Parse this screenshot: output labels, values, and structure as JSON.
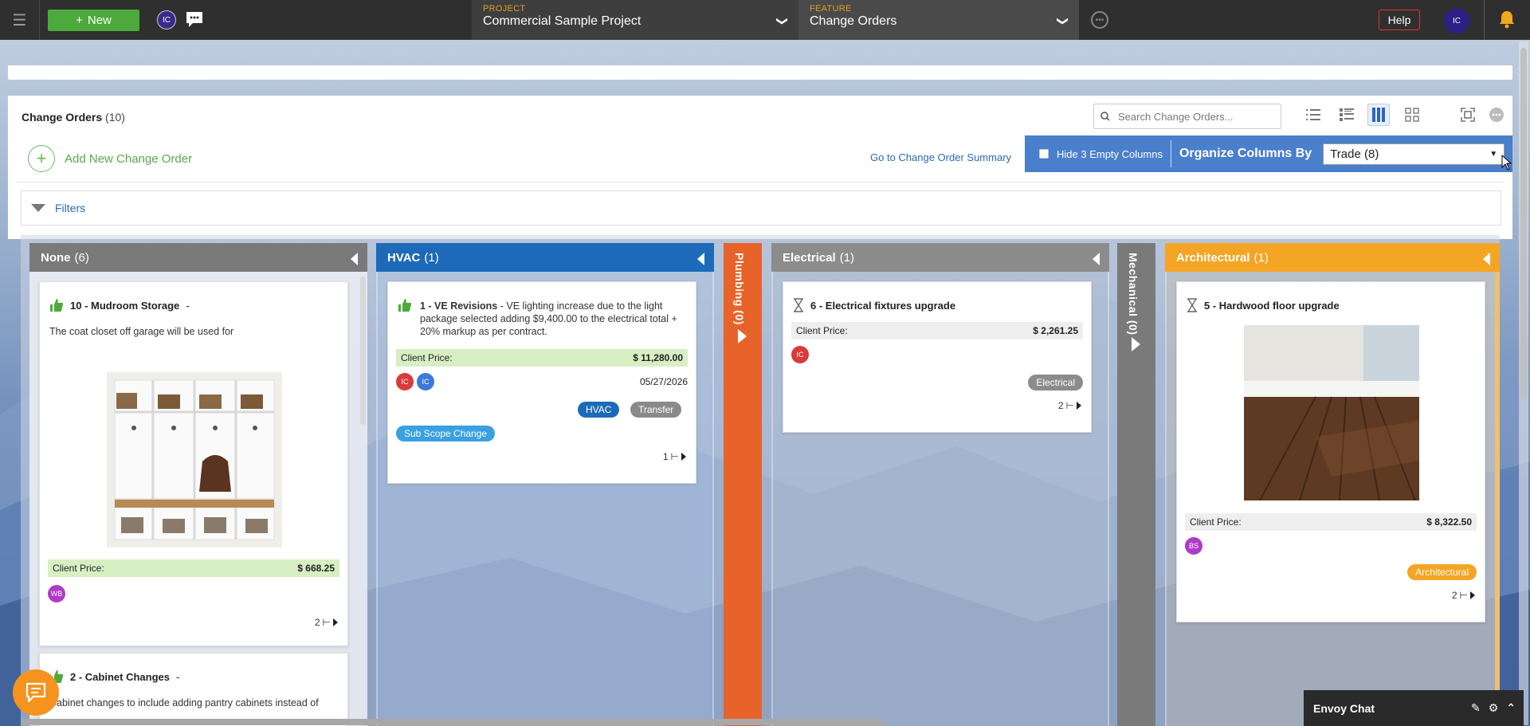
{
  "topbar": {
    "new_label": "New",
    "user_initials": "IC",
    "project_label": "PROJECT",
    "project_value": "Commercial Sample Project",
    "feature_label": "FEATURE",
    "feature_value": "Change Orders",
    "help_label": "Help",
    "account_initials": "IC"
  },
  "panel": {
    "title": "Change Orders",
    "count": "(10)",
    "search_placeholder": "Search Change Orders...",
    "add_new_label": "Add New Change Order",
    "goto_summary": "Go to Change Order Summary",
    "hide_empty_label": "Hide 3 Empty Columns",
    "organize_label": "Organize Columns By",
    "organize_value": "Trade (8)",
    "filters_label": "Filters"
  },
  "columns": [
    {
      "name": "None",
      "count": "(6)",
      "color": "#7a7a7a"
    },
    {
      "name": "HVAC",
      "count": "(1)",
      "color": "#1d6bb8"
    },
    {
      "name": "Plumbing (0)",
      "color": "#e8632a",
      "vertical": true
    },
    {
      "name": "Electrical",
      "count": "(1)",
      "color": "#8c8c8c"
    },
    {
      "name": "Mechanical (0)",
      "color": "#7a7a7a",
      "vertical": true
    },
    {
      "name": "Architectural",
      "count": "(1)",
      "color": "#f5a524"
    }
  ],
  "cards": {
    "mudroom": {
      "number_title": "10 - Mudroom Storage",
      "suffix": "-",
      "description": "The coat closet off garage will be used for",
      "price_label": "Client Price:",
      "price": "$ 668.25",
      "avatar": "WB",
      "sub_count": "2"
    },
    "cabinet": {
      "number_title": "2 - Cabinet Changes",
      "suffix": "-",
      "description": "Cabinet changes to include adding pantry cabinets instead of"
    },
    "hvac": {
      "number_title": "1 - VE Revisions",
      "suffix": "-",
      "description": "VE lighting increase due to the light package selected adding $9,400.00 to the electrical total + 20% markup as per contract.",
      "price_label": "Client Price:",
      "price": "$ 11,280.00",
      "avatar1": "IC",
      "avatar2": "IC",
      "date": "05/27/2026",
      "tag1": "HVAC",
      "tag2": "Transfer",
      "tag3": "Sub Scope Change",
      "sub_count": "1"
    },
    "electrical": {
      "number_title": "6 - Electrical fixtures upgrade",
      "price_label": "Client Price:",
      "price": "$ 2,261.25",
      "avatar": "IC",
      "tag": "Electrical",
      "sub_count": "2"
    },
    "architectural": {
      "number_title": "5 - Hardwood floor upgrade",
      "price_label": "Client Price:",
      "price": "$ 8,322.50",
      "avatar": "BS",
      "tag": "Architectural",
      "sub_count": "2"
    }
  },
  "chat": {
    "envoy_title": "Envoy Chat"
  }
}
